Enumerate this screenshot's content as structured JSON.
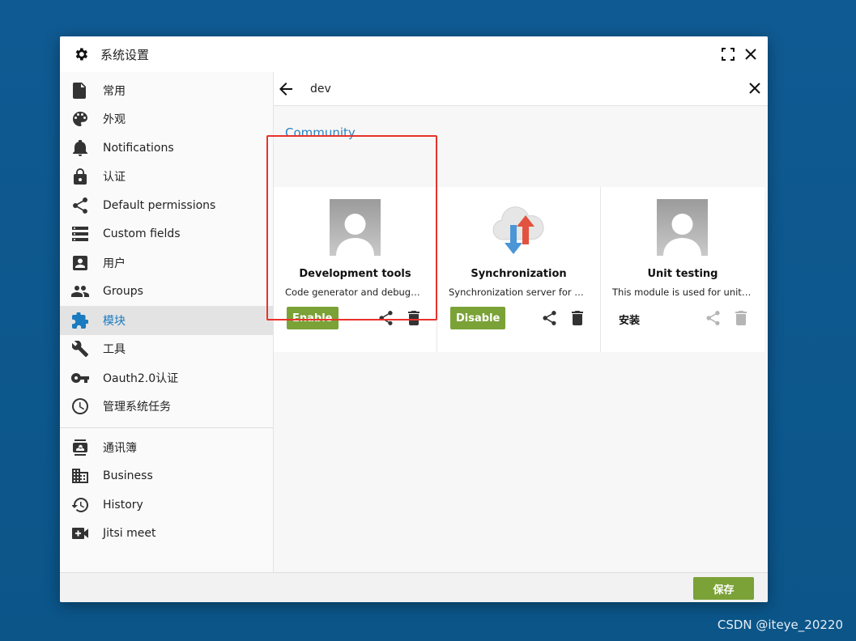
{
  "window": {
    "title": "系统设置",
    "title_icon": "gear-icon"
  },
  "sidebar": {
    "items": [
      {
        "label": "常用",
        "icon": "document-icon"
      },
      {
        "label": "外观",
        "icon": "palette-icon"
      },
      {
        "label": "Notifications",
        "icon": "bell-icon"
      },
      {
        "label": "认证",
        "icon": "lock-icon"
      },
      {
        "label": "Default permissions",
        "icon": "share-icon"
      },
      {
        "label": "Custom fields",
        "icon": "list-icon"
      },
      {
        "label": "用户",
        "icon": "user-card-icon"
      },
      {
        "label": "Groups",
        "icon": "group-icon"
      },
      {
        "label": "模块",
        "icon": "puzzle-icon",
        "active": true
      },
      {
        "label": "工具",
        "icon": "wrench-icon"
      },
      {
        "label": "Oauth2.0认证",
        "icon": "key-icon"
      },
      {
        "label": "管理系统任务",
        "icon": "clock-icon"
      }
    ],
    "secondary_items": [
      {
        "label": "通讯簿",
        "icon": "contacts-icon"
      },
      {
        "label": "Business",
        "icon": "building-icon"
      },
      {
        "label": "History",
        "icon": "history-icon"
      },
      {
        "label": "Jitsi meet",
        "icon": "video-icon"
      }
    ]
  },
  "search": {
    "value": "dev"
  },
  "section": {
    "title": "Community"
  },
  "cards": [
    {
      "name": "Development tools",
      "description": "Code generator and debugging...",
      "action_label": "Enable",
      "action_type": "button",
      "thumb": "avatar-placeholder"
    },
    {
      "name": "Synchronization",
      "description": "Synchronization server for mo...",
      "action_label": "Disable",
      "action_type": "button",
      "thumb": "cloud-sync-icon"
    },
    {
      "name": "Unit testing",
      "description": "This module is used for unit te...",
      "action_label": "安装",
      "action_type": "text",
      "thumb": "avatar-placeholder"
    }
  ],
  "footer": {
    "save_label": "保存"
  },
  "watermark": "CSDN @iteye_20220",
  "colors": {
    "accent": "#2a82c1",
    "button_green": "#7aa237",
    "highlight_red": "#e8322b",
    "desktop_blue": "#0f5a92"
  }
}
